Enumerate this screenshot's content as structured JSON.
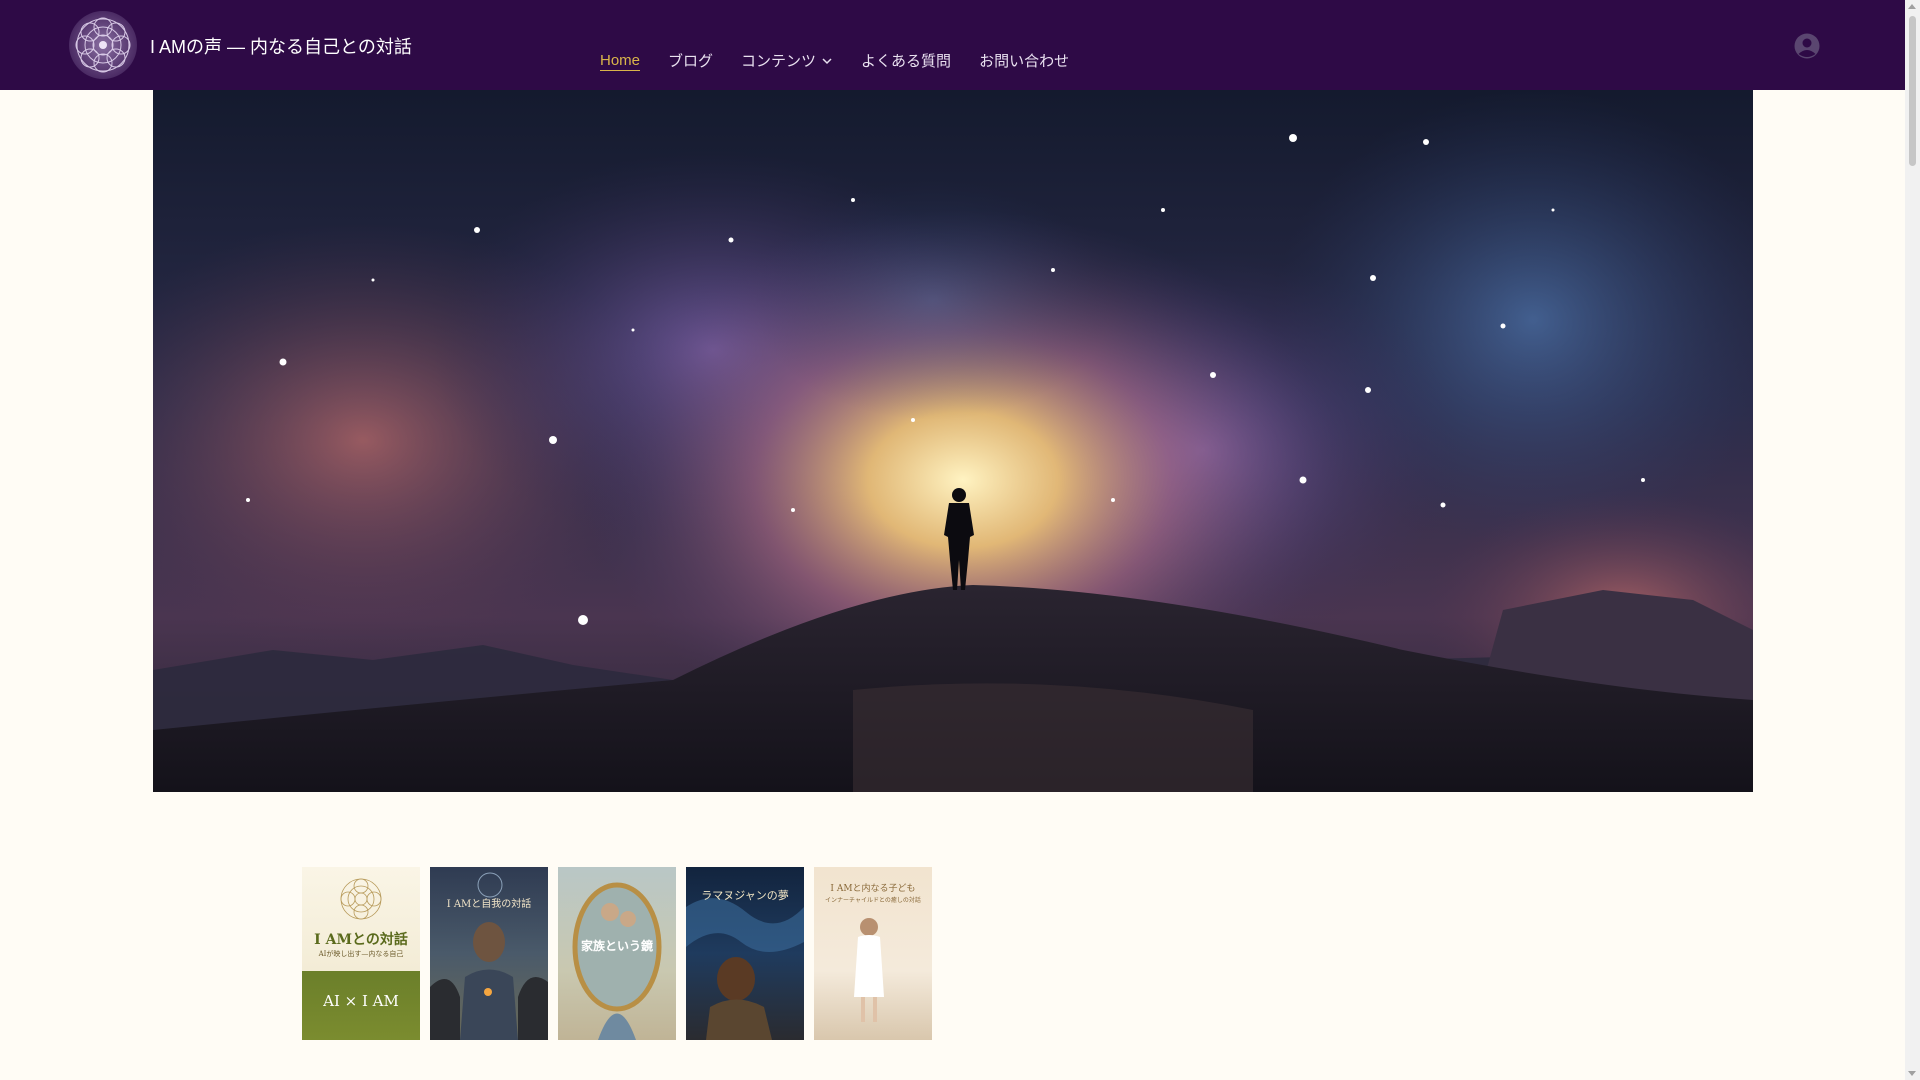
{
  "site": {
    "title": "I AMの声 — 内なる自己との対話"
  },
  "nav": {
    "items": [
      {
        "label": "Home",
        "active": true
      },
      {
        "label": "ブログ",
        "active": false
      },
      {
        "label": "コンテンツ",
        "active": false,
        "has_dropdown": true
      },
      {
        "label": "よくある質問",
        "active": false
      },
      {
        "label": "お問い合わせ",
        "active": false
      }
    ]
  },
  "books": [
    {
      "title": "I AMとの対話",
      "subtitle": "AIが映し出す—内なる自己",
      "band_top": "AI × I AM"
    },
    {
      "title": "I AMと自我の対話"
    },
    {
      "title": "家族という鏡"
    },
    {
      "title": "ラマヌジャンの夢"
    },
    {
      "title": "I AMと内なる子ども",
      "subtitle": "インナーチャイルドとの癒しの対話"
    }
  ],
  "colors": {
    "header_bg": "#2e0a46",
    "nav_active": "#d9b54a",
    "page_bg": "#fffcf5"
  },
  "icons": {
    "logo": "mandala-icon",
    "account": "user-circle-icon",
    "dropdown": "chevron-down-icon"
  }
}
